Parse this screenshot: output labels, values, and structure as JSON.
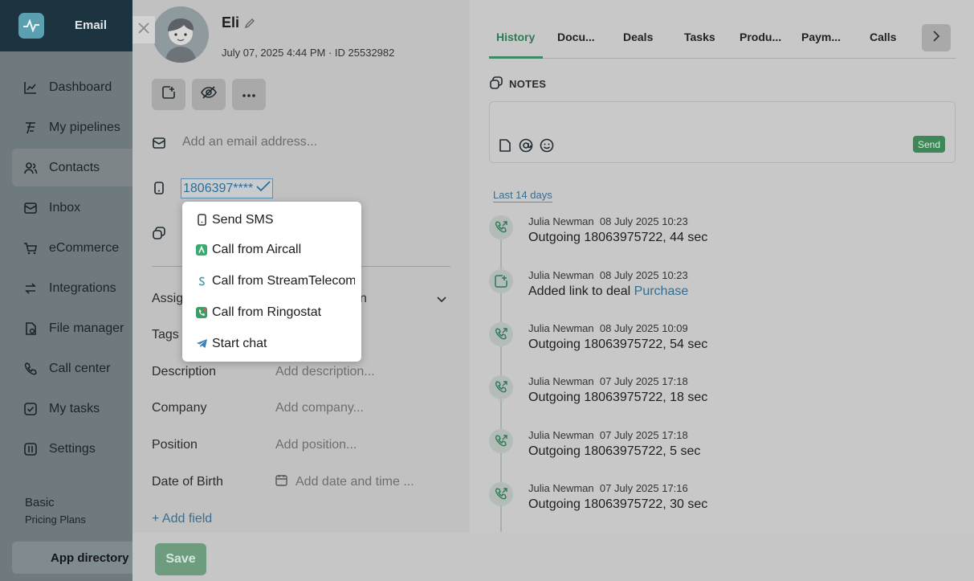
{
  "sidebar": {
    "title": "Email",
    "items": [
      {
        "label": "Dashboard",
        "icon": "chart-line-icon"
      },
      {
        "label": "My pipelines",
        "icon": "funnel-icon"
      },
      {
        "label": "Contacts",
        "icon": "users-icon"
      },
      {
        "label": "Inbox",
        "icon": "inbox-icon"
      },
      {
        "label": "eCommerce",
        "icon": "cart-icon"
      },
      {
        "label": "Integrations",
        "icon": "arrows-icon"
      },
      {
        "label": "File manager",
        "icon": "file-icon"
      },
      {
        "label": "Call center",
        "icon": "phone-icon"
      },
      {
        "label": "My tasks",
        "icon": "check-square-icon"
      },
      {
        "label": "Settings",
        "icon": "settings-icon"
      }
    ],
    "plan_name": "Basic",
    "plan_sub": "Pricing Plans",
    "app_directory": "App directory"
  },
  "contact": {
    "name": "Eli",
    "meta": "July 07, 2025 4:44 PM  · ID 25532982",
    "email_placeholder": "Add an email address...",
    "phone": "1806397****",
    "assign_label": "Assig",
    "assign_tail": "n",
    "tags_label": "Tags",
    "fields": [
      {
        "label": "Description",
        "placeholder": "Add description..."
      },
      {
        "label": "Company",
        "placeholder": "Add company..."
      },
      {
        "label": "Position",
        "placeholder": "Add position..."
      },
      {
        "label": "Date of Birth",
        "placeholder": "Add date and time ..."
      }
    ],
    "add_field": "+ Add field"
  },
  "phone_menu": [
    {
      "label": "Send SMS",
      "icon": "mobile-icon"
    },
    {
      "label": "Call from Aircall",
      "icon": "aircall-icon"
    },
    {
      "label": "Call from StreamTelecom",
      "icon": "streamtelecom-icon"
    },
    {
      "label": "Call from Ringostat",
      "icon": "ringostat-icon"
    },
    {
      "label": "Start chat",
      "icon": "telegram-icon"
    }
  ],
  "save_label": "Save",
  "tabs": [
    "History",
    "Docu...",
    "Deals",
    "Tasks",
    "Produ...",
    "Paym...",
    "Calls"
  ],
  "notes": {
    "heading": "NOTES",
    "send_label": "Send"
  },
  "period": "Last 14 days",
  "history": [
    {
      "author": "Julia Newman",
      "time": "08 July 2025 10:23",
      "text": "Outgoing 18063975722, 44 sec",
      "icon": "outgoing-call-icon"
    },
    {
      "author": "Julia Newman",
      "time": "08 July 2025 10:23",
      "text": "Added link to deal ",
      "link": "Purchase",
      "icon": "deal-link-icon"
    },
    {
      "author": "Julia Newman",
      "time": "08 July 2025 10:09",
      "text": "Outgoing 18063975722, 54 sec",
      "icon": "outgoing-call-icon"
    },
    {
      "author": "Julia Newman",
      "time": "07 July 2025 17:18",
      "text": "Outgoing 18063975722, 18 sec",
      "icon": "outgoing-call-icon"
    },
    {
      "author": "Julia Newman",
      "time": "07 July 2025 17:18",
      "text": "Outgoing 18063975722, 5 sec",
      "icon": "outgoing-call-icon"
    },
    {
      "author": "Julia Newman",
      "time": "07 July 2025 17:16",
      "text": "Outgoing 18063975722, 30 sec",
      "icon": "outgoing-call-icon"
    }
  ],
  "colors": {
    "accent_green": "#3e8759",
    "link_blue": "#2f6f93",
    "sidebar_head": "#1c3440"
  }
}
